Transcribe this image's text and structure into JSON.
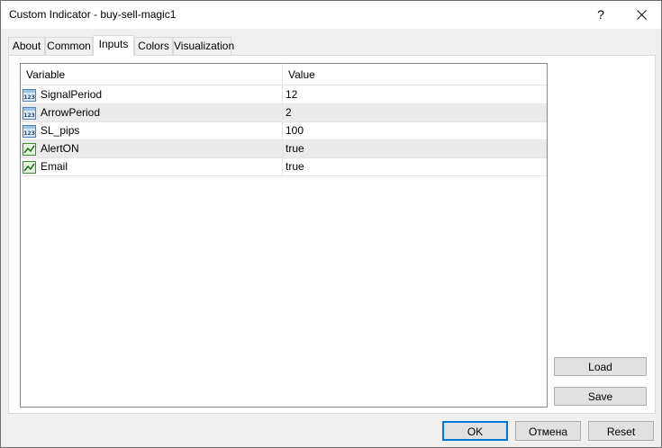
{
  "window": {
    "title": "Custom Indicator - buy-sell-magic1",
    "help_symbol": "?",
    "close_icon": "close-icon"
  },
  "tabs": [
    {
      "label": "About",
      "active": false
    },
    {
      "label": "Common",
      "active": false
    },
    {
      "label": "Inputs",
      "active": true
    },
    {
      "label": "Colors",
      "active": false
    },
    {
      "label": "Visualization",
      "active": false
    }
  ],
  "grid": {
    "headers": {
      "variable": "Variable",
      "value": "Value"
    },
    "rows": [
      {
        "icon": "integer-123-icon",
        "name": "SignalPeriod",
        "value": "12"
      },
      {
        "icon": "integer-123-icon",
        "name": "ArrowPeriod",
        "value": "2"
      },
      {
        "icon": "integer-123-icon",
        "name": "SL_pips",
        "value": "100"
      },
      {
        "icon": "boolean-chart-icon",
        "name": "AlertON",
        "value": "true"
      },
      {
        "icon": "boolean-chart-icon",
        "name": "Email",
        "value": "true"
      }
    ]
  },
  "side_buttons": {
    "load": "Load",
    "save": "Save"
  },
  "footer_buttons": {
    "ok": "OK",
    "cancel": "Отмена",
    "reset": "Reset"
  },
  "colors": {
    "focus_border": "#0078d7",
    "row_alt": "#ebebeb"
  }
}
